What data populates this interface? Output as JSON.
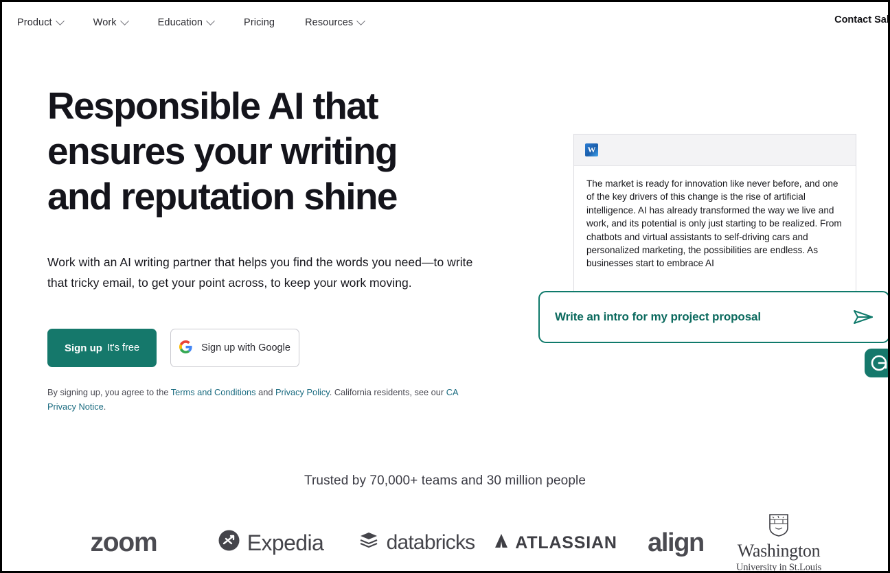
{
  "nav": {
    "items": [
      {
        "label": "Product",
        "has_chevron": true,
        "icon": "chevron-down-icon"
      },
      {
        "label": "Work",
        "has_chevron": true,
        "icon": "chevron-down-icon"
      },
      {
        "label": "Education",
        "has_chevron": true,
        "icon": "chevron-down-icon"
      },
      {
        "label": "Pricing",
        "has_chevron": false,
        "icon": ""
      },
      {
        "label": "Resources",
        "has_chevron": true,
        "icon": "chevron-down-icon"
      }
    ],
    "contact_sales": "Contact Sales"
  },
  "hero": {
    "title": "Responsible AI that ensures your writing and reputation shine",
    "subtitle": "Work with an AI writing partner that helps you find the words you need—to write that tricky email, to get your point across, to keep your work moving.",
    "cta": {
      "signup_strong": "Sign up",
      "signup_free": "It's free",
      "google_label": "Sign up with Google",
      "google_icon": "google-g-icon",
      "primary_color": "#15786b"
    },
    "legal": {
      "part1": "By signing up, you agree to the ",
      "terms_link": "Terms and Conditions",
      "part2": " and ",
      "privacy_link": "Privacy Policy",
      "part3": ". California residents, see our ",
      "ca_link": "CA Privacy Notice",
      "part4": "."
    }
  },
  "doc_panel": {
    "app_icon": "microsoft-word-icon",
    "app_icon_letter": "W",
    "body_text": "The market is ready for innovation like never before, and one of the key drivers of this change is the rise of artificial intelligence. AI has already transformed the way we live and work, and its potential is only just starting to be realized. From chatbots and virtual assistants to self-driving cars and personalized marketing, the possibilities are endless. As businesses start to embrace AI"
  },
  "prompt": {
    "text": "Write an intro for my project proposal",
    "send_icon": "send-paper-plane-icon",
    "accent_color": "#0f7a6b"
  },
  "grammarly_badge": {
    "icon": "grammarly-g-icon",
    "color": "#15786b"
  },
  "social_proof": {
    "trusted_text": "Trusted by 70,000+ teams and 30 million people",
    "logos": [
      {
        "name": "zoom",
        "label": "zoom"
      },
      {
        "name": "expedia",
        "label": "Expedia"
      },
      {
        "name": "databricks",
        "label": "databricks"
      },
      {
        "name": "atlassian",
        "label": "ATLASSIAN"
      },
      {
        "name": "align",
        "label": "align"
      },
      {
        "name": "washu",
        "label_line1": "Washington",
        "label_line2": "University in St.Louis"
      }
    ]
  }
}
